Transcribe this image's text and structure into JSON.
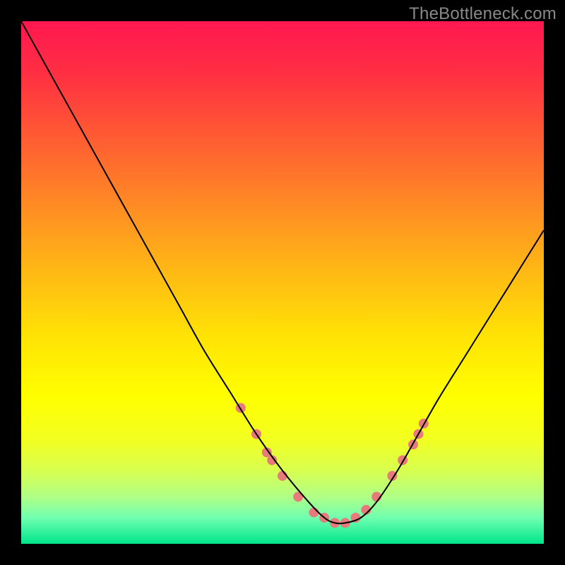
{
  "watermark": "TheBottleneck.com",
  "chart_data": {
    "type": "line",
    "title": "",
    "xlabel": "",
    "ylabel": "",
    "xlim": [
      0,
      100
    ],
    "ylim": [
      0,
      100
    ],
    "background_gradient": {
      "stops": [
        {
          "offset": 0.0,
          "color": "#ff1750"
        },
        {
          "offset": 0.1,
          "color": "#ff2f43"
        },
        {
          "offset": 0.22,
          "color": "#ff5a33"
        },
        {
          "offset": 0.35,
          "color": "#ff8a24"
        },
        {
          "offset": 0.48,
          "color": "#ffb914"
        },
        {
          "offset": 0.6,
          "color": "#ffe205"
        },
        {
          "offset": 0.72,
          "color": "#ffff00"
        },
        {
          "offset": 0.8,
          "color": "#f2ff20"
        },
        {
          "offset": 0.86,
          "color": "#d8ff50"
        },
        {
          "offset": 0.91,
          "color": "#b0ff86"
        },
        {
          "offset": 0.95,
          "color": "#70ffb0"
        },
        {
          "offset": 1.0,
          "color": "#00e58a"
        }
      ]
    },
    "series": [
      {
        "name": "bottleneck-curve",
        "color": "#000000",
        "x": [
          0,
          5,
          10,
          15,
          20,
          25,
          30,
          35,
          40,
          45,
          50,
          55,
          58,
          60,
          62,
          65,
          68,
          72,
          76,
          80,
          85,
          90,
          95,
          100
        ],
        "y": [
          100,
          91,
          82,
          73,
          64,
          55,
          46,
          37,
          29,
          21,
          14,
          8,
          5,
          4,
          4,
          5,
          8,
          14,
          21,
          28,
          36,
          44,
          52,
          60
        ]
      }
    ],
    "markers": {
      "name": "highlight-points",
      "color": "#e77a7a",
      "radius": 7,
      "points": [
        {
          "x": 42,
          "y": 26
        },
        {
          "x": 45,
          "y": 21
        },
        {
          "x": 47,
          "y": 17.5
        },
        {
          "x": 48,
          "y": 16
        },
        {
          "x": 50,
          "y": 13
        },
        {
          "x": 53,
          "y": 9
        },
        {
          "x": 56,
          "y": 6
        },
        {
          "x": 58,
          "y": 5
        },
        {
          "x": 60,
          "y": 4
        },
        {
          "x": 62,
          "y": 4
        },
        {
          "x": 64,
          "y": 5
        },
        {
          "x": 66,
          "y": 6.5
        },
        {
          "x": 68,
          "y": 9
        },
        {
          "x": 71,
          "y": 13
        },
        {
          "x": 73,
          "y": 16
        },
        {
          "x": 75,
          "y": 19
        },
        {
          "x": 76,
          "y": 21
        },
        {
          "x": 77,
          "y": 23
        }
      ]
    }
  }
}
